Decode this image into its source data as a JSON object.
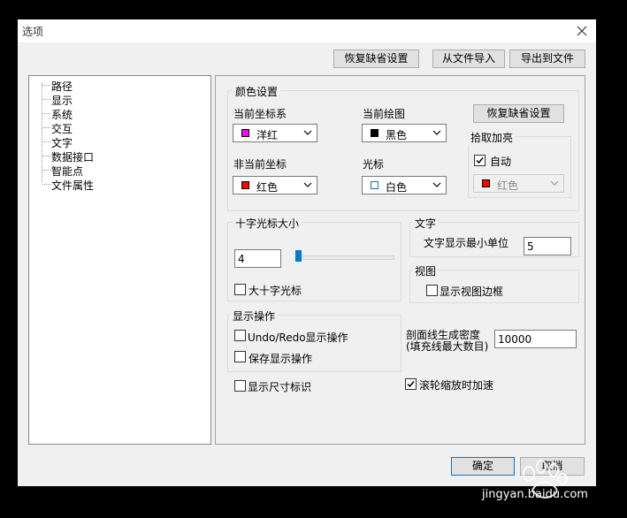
{
  "window": {
    "title": "选项",
    "close_label": "close"
  },
  "toolbar": {
    "restore_defaults": "恢复缺省设置",
    "import_from_file": "从文件导入",
    "export_to_file": "导出到文件"
  },
  "tree": {
    "items": [
      "路径",
      "显示",
      "系统",
      "交互",
      "文字",
      "数据接口",
      "智能点",
      "文件属性"
    ]
  },
  "colors_group": {
    "title": "颜色设置",
    "current_coord": {
      "label": "当前坐标系",
      "value": "洋红",
      "color": "#ff00ff"
    },
    "current_draw": {
      "label": "当前绘图",
      "value": "黑色",
      "color": "#000000"
    },
    "noncurrent_coord": {
      "label": "非当前坐标",
      "value": "红色",
      "color": "#ff0000"
    },
    "cursor": {
      "label": "光标",
      "value": "白色",
      "color": "#ffffff"
    },
    "restore_button": "恢复缺省设置",
    "pick_highlight": {
      "title": "拾取加亮",
      "auto_label": "自动",
      "auto_checked": true,
      "value": "红色",
      "color": "#ff0000"
    }
  },
  "crosshair_group": {
    "title": "十字光标大小",
    "size_value": "4",
    "slider_fraction": 0.05,
    "big_crosshair_label": "大十字光标",
    "big_crosshair_checked": false
  },
  "text_group": {
    "title": "文字",
    "min_unit_label": "文字显示最小单位",
    "min_unit_value": "5"
  },
  "view_group": {
    "title": "视图",
    "show_border_label": "显示视图边框",
    "show_border_checked": false
  },
  "display_ops_group": {
    "title": "显示操作",
    "undo_redo_label": "Undo/Redo显示操作",
    "undo_redo_checked": false,
    "save_display_label": "保存显示操作",
    "save_display_checked": false
  },
  "hatch": {
    "label_line1": "剖面线生成密度",
    "label_line2": "(填充线最大数目)",
    "value": "10000"
  },
  "show_dim_label": "显示尺寸标识",
  "show_dim_checked": false,
  "wheel_zoom_label": "滚轮缩放时加速",
  "wheel_zoom_checked": true,
  "footer": {
    "ok": "确定",
    "cancel": "取消"
  },
  "watermark": {
    "site": "jingyan.baidu.com"
  }
}
